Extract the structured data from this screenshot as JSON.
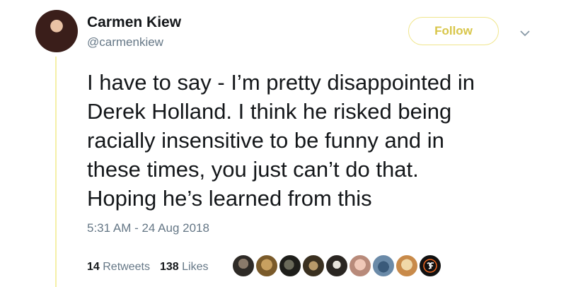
{
  "author": {
    "display_name": "Carmen Kiew",
    "handle": "@carmenkiew"
  },
  "follow_label": "Follow",
  "tweet": {
    "text": "I have to say - I’m pretty disappointed in\nDerek Holland. I think he risked being\nracially insensitive to be funny and in\nthese times, you just can’t do that.\nHoping he’s learned from this",
    "timestamp": "5:31 AM - 24 Aug 2018"
  },
  "stats": {
    "retweets_count": "14",
    "retweets_label": "Retweets",
    "likes_count": "138",
    "likes_label": "Likes"
  },
  "colors": {
    "follow_accent": "#d8c64a",
    "thread_line": "#f5f0a8",
    "secondary_text": "#657786"
  },
  "liker_avatars": [
    {
      "icon": "liker-avatar"
    },
    {
      "icon": "liker-avatar"
    },
    {
      "icon": "liker-avatar"
    },
    {
      "icon": "liker-avatar"
    },
    {
      "icon": "liker-avatar"
    },
    {
      "icon": "liker-avatar"
    },
    {
      "icon": "liker-avatar"
    },
    {
      "icon": "liker-avatar"
    },
    {
      "icon": "sf-giants-logo-avatar"
    }
  ]
}
